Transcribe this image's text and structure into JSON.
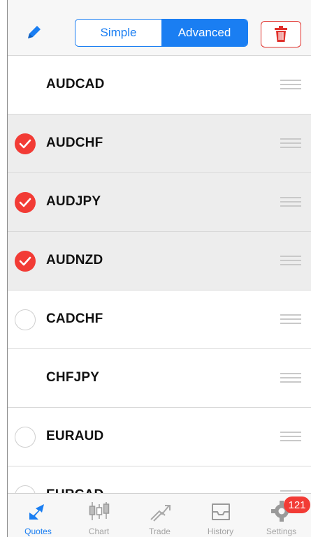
{
  "toolbar": {
    "mode_simple": "Simple",
    "mode_advanced": "Advanced",
    "active_mode": "Advanced"
  },
  "symbols": [
    {
      "name": "AUDCAD",
      "checkbox": "none"
    },
    {
      "name": "AUDCHF",
      "checkbox": "checked"
    },
    {
      "name": "AUDJPY",
      "checkbox": "checked"
    },
    {
      "name": "AUDNZD",
      "checkbox": "checked"
    },
    {
      "name": "CADCHF",
      "checkbox": "unchecked"
    },
    {
      "name": "CHFJPY",
      "checkbox": "none"
    },
    {
      "name": "EURAUD",
      "checkbox": "unchecked"
    },
    {
      "name": "EURCAD",
      "checkbox": "unchecked"
    }
  ],
  "tabs": [
    {
      "label": "Quotes",
      "icon": "quotes-icon",
      "active": true
    },
    {
      "label": "Chart",
      "icon": "chart-icon"
    },
    {
      "label": "Trade",
      "icon": "trade-icon"
    },
    {
      "label": "History",
      "icon": "history-icon"
    },
    {
      "label": "Settings",
      "icon": "gear-icon",
      "badge": "121"
    }
  ],
  "colors": {
    "accent": "#1a7ef2",
    "danger": "#f23b35",
    "selected_row": "#ededed"
  }
}
